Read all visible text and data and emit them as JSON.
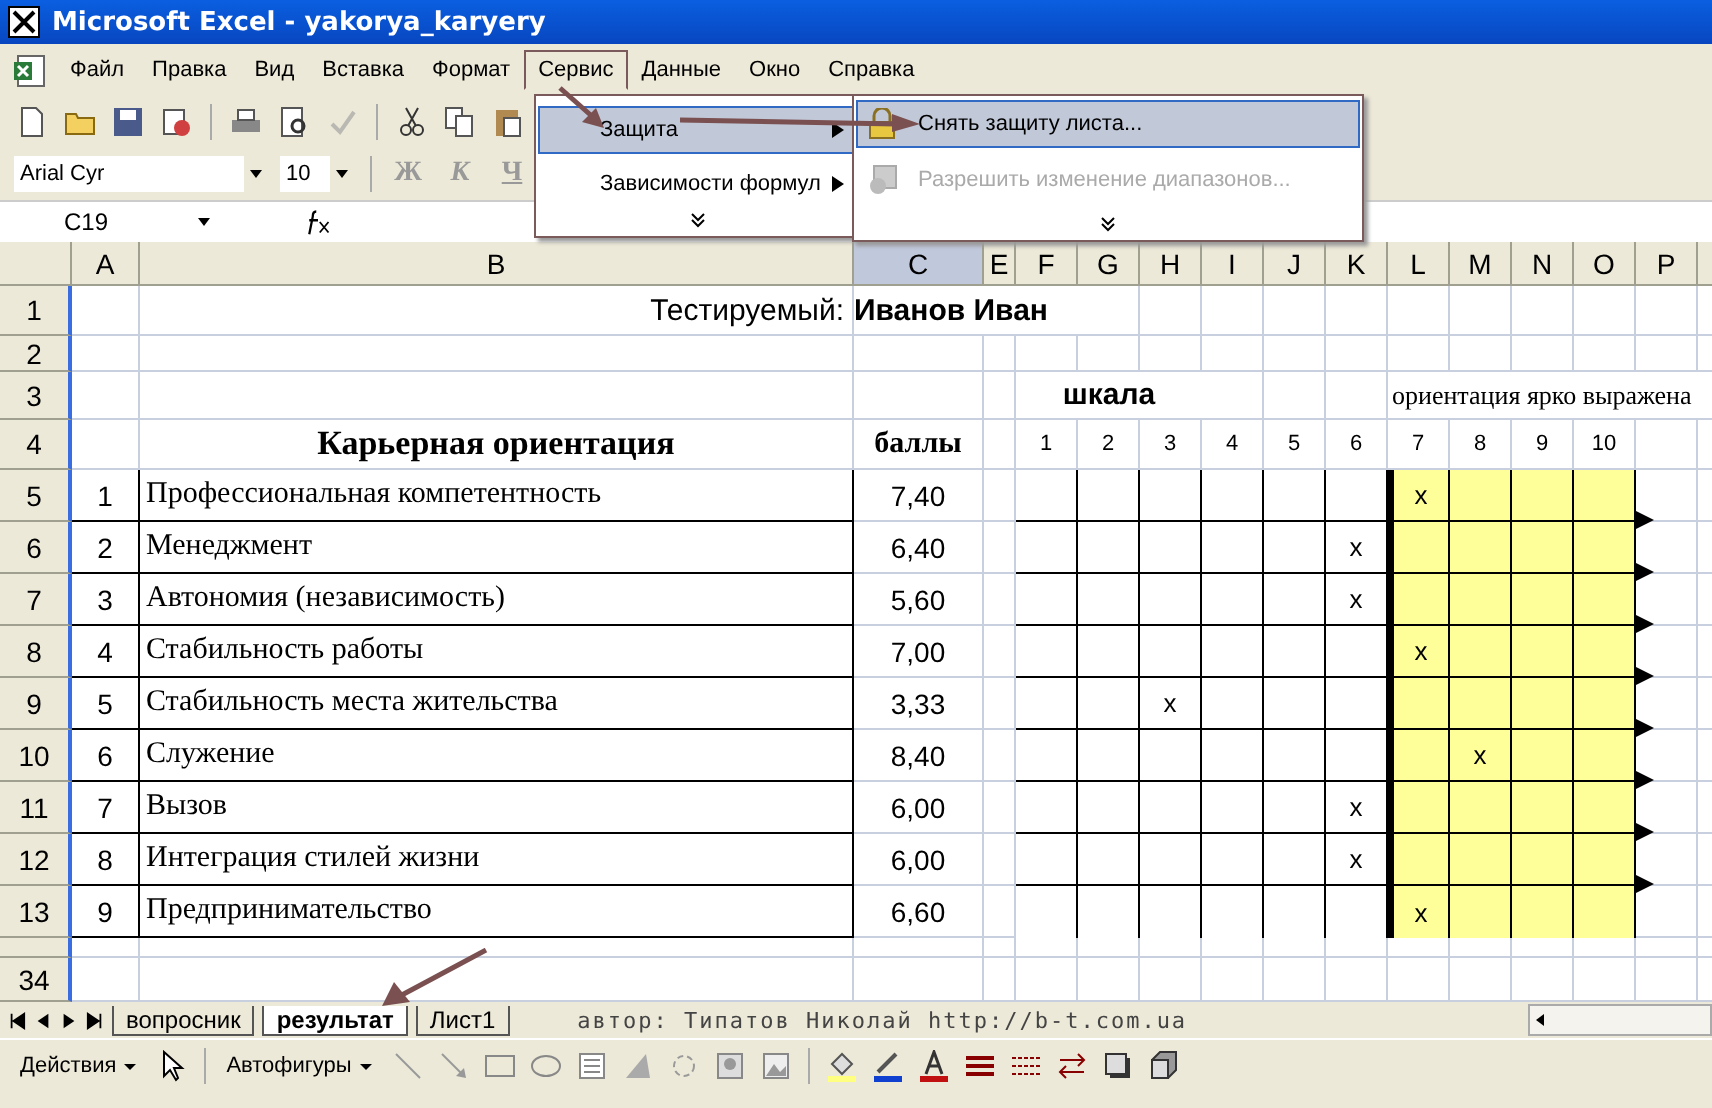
{
  "window": {
    "title": "Microsoft Excel - yakorya_karyery"
  },
  "menu": [
    {
      "label": "Файл",
      "selected": false
    },
    {
      "label": "Правка",
      "selected": false
    },
    {
      "label": "Вид",
      "selected": false
    },
    {
      "label": "Вставка",
      "selected": false
    },
    {
      "label": "Формат",
      "selected": false
    },
    {
      "label": "Сервис",
      "selected": true
    },
    {
      "label": "Данные",
      "selected": false
    },
    {
      "label": "Окно",
      "selected": false
    },
    {
      "label": "Справка",
      "selected": false
    }
  ],
  "dropdown": {
    "items": [
      {
        "label": "Защита",
        "selected": true,
        "submenu": true
      },
      {
        "label": "Зависимости формул",
        "selected": false,
        "submenu": true
      }
    ]
  },
  "submenu": {
    "items": [
      {
        "label": "Снять защиту листа...",
        "selected": true,
        "disabled": false
      },
      {
        "label": "Разрешить изменение диапазонов...",
        "selected": false,
        "disabled": true
      }
    ]
  },
  "formatting": {
    "font": "Arial Cyr",
    "size": "10",
    "bold": "Ж",
    "italic": "К",
    "underline": "Ч"
  },
  "formula_bar": {
    "name_box": "C19"
  },
  "columns": [
    {
      "label": "A",
      "selected": false
    },
    {
      "label": "B",
      "selected": false
    },
    {
      "label": "C",
      "selected": true
    },
    {
      "label": "E",
      "selected": false
    },
    {
      "label": "F",
      "selected": false
    },
    {
      "label": "G",
      "selected": false
    },
    {
      "label": "H",
      "selected": false
    },
    {
      "label": "I",
      "selected": false
    },
    {
      "label": "J",
      "selected": false
    },
    {
      "label": "K",
      "selected": false
    },
    {
      "label": "L",
      "selected": false
    },
    {
      "label": "M",
      "selected": false
    },
    {
      "label": "N",
      "selected": false
    },
    {
      "label": "O",
      "selected": false
    },
    {
      "label": "P",
      "selected": false
    }
  ],
  "sheet": {
    "row_numbers": [
      "1",
      "2",
      "3",
      "4"
    ],
    "subject_label": "Тестируемый:",
    "subject_name": "Иванов Иван",
    "scale_title": "шкала",
    "strong_label": "ориентация ярко выражена",
    "heading": "Карьерная ориентация",
    "score_heading": "баллы",
    "scale": [
      {
        "label": "1",
        "highlighted": false
      },
      {
        "label": "2",
        "highlighted": false
      },
      {
        "label": "3",
        "highlighted": false
      },
      {
        "label": "4",
        "highlighted": false
      },
      {
        "label": "5",
        "highlighted": false
      },
      {
        "label": "6",
        "highlighted": false
      },
      {
        "label": "7",
        "highlighted": true
      },
      {
        "label": "8",
        "highlighted": true
      },
      {
        "label": "9",
        "highlighted": true
      },
      {
        "label": "10",
        "highlighted": true
      }
    ],
    "rows": [
      {
        "row": "5",
        "num": "1",
        "name": "Профессиональная компетентность",
        "score": "7,40",
        "mark": "x",
        "marks": [
          false,
          false,
          false,
          false,
          false,
          false,
          true,
          false,
          false,
          false
        ]
      },
      {
        "row": "6",
        "num": "2",
        "name": "Менеджмент",
        "score": "6,40",
        "mark": "x",
        "marks": [
          false,
          false,
          false,
          false,
          false,
          true,
          false,
          false,
          false,
          false
        ]
      },
      {
        "row": "7",
        "num": "3",
        "name": "Автономия (независимость)",
        "score": "5,60",
        "mark": "x",
        "marks": [
          false,
          false,
          false,
          false,
          false,
          true,
          false,
          false,
          false,
          false
        ]
      },
      {
        "row": "8",
        "num": "4",
        "name": "Стабильность работы",
        "score": "7,00",
        "mark": "x",
        "marks": [
          false,
          false,
          false,
          false,
          false,
          false,
          true,
          false,
          false,
          false
        ]
      },
      {
        "row": "9",
        "num": "5",
        "name": "Стабильность места жительства",
        "score": "3,33",
        "mark": "x",
        "marks": [
          false,
          false,
          true,
          false,
          false,
          false,
          false,
          false,
          false,
          false
        ]
      },
      {
        "row": "10",
        "num": "6",
        "name": "Служение",
        "score": "8,40",
        "mark": "x",
        "marks": [
          false,
          false,
          false,
          false,
          false,
          false,
          false,
          true,
          false,
          false
        ]
      },
      {
        "row": "11",
        "num": "7",
        "name": "Вызов",
        "score": "6,00",
        "mark": "x",
        "marks": [
          false,
          false,
          false,
          false,
          false,
          true,
          false,
          false,
          false,
          false
        ]
      },
      {
        "row": "12",
        "num": "8",
        "name": "Интеграция стилей жизни",
        "score": "6,00",
        "mark": "x",
        "marks": [
          false,
          false,
          false,
          false,
          false,
          true,
          false,
          false,
          false,
          false
        ]
      },
      {
        "row": "13",
        "num": "9",
        "name": "Предпринимательство",
        "score": "6,60",
        "mark": "x",
        "marks": [
          false,
          false,
          false,
          false,
          false,
          false,
          true,
          false,
          false,
          false
        ]
      }
    ],
    "last_row": "34"
  },
  "sheet_tabs": [
    {
      "label": "вопросник",
      "selected": false
    },
    {
      "label": "результат",
      "selected": true
    },
    {
      "label": "Лист1",
      "selected": false
    }
  ],
  "author_note": "автор: Типатов Николай http://b-t.com.ua",
  "drawing_toolbar": {
    "actions": "Действия",
    "autoshapes": "Автофигуры"
  }
}
